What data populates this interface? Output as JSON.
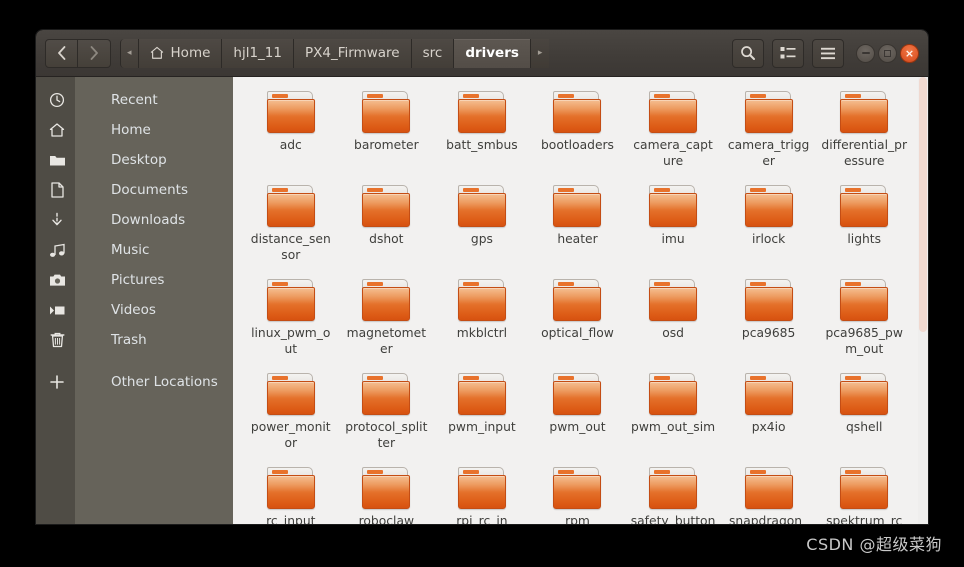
{
  "window": {
    "title": "drivers",
    "nav": {
      "back_label": "‹",
      "forward_label": "›"
    },
    "breadcrumb": {
      "overflow_left": "◂",
      "overflow_right": "▸",
      "items": [
        {
          "label": "Home",
          "icon": "home-icon",
          "current": false
        },
        {
          "label": "hjl1_11",
          "icon": "",
          "current": false
        },
        {
          "label": "PX4_Firmware",
          "icon": "",
          "current": false
        },
        {
          "label": "src",
          "icon": "",
          "current": false
        },
        {
          "label": "drivers",
          "icon": "",
          "current": true
        }
      ]
    },
    "toolbar": {
      "search_label": "search-icon",
      "view_label": "list-view-icon",
      "menu_label": "hamburger-menu-icon"
    },
    "controls": {
      "minimize_label": "minimize",
      "maximize_label": "maximize",
      "close_label": "×"
    }
  },
  "sidebar": {
    "items": [
      {
        "label": "Recent",
        "icon": "clock-icon"
      },
      {
        "label": "Home",
        "icon": "home-icon"
      },
      {
        "label": "Desktop",
        "icon": "folder-icon"
      },
      {
        "label": "Documents",
        "icon": "document-icon"
      },
      {
        "label": "Downloads",
        "icon": "download-icon"
      },
      {
        "label": "Music",
        "icon": "music-note-icon"
      },
      {
        "label": "Pictures",
        "icon": "camera-icon"
      },
      {
        "label": "Videos",
        "icon": "video-icon"
      },
      {
        "label": "Trash",
        "icon": "trash-icon"
      },
      {
        "label": "Other Locations",
        "icon": "plus-icon"
      }
    ]
  },
  "files": {
    "items": [
      {
        "name": "adc",
        "type": "folder"
      },
      {
        "name": "barometer",
        "type": "folder"
      },
      {
        "name": "batt_smbus",
        "type": "folder"
      },
      {
        "name": "bootloaders",
        "type": "folder"
      },
      {
        "name": "camera_capture",
        "type": "folder"
      },
      {
        "name": "camera_trigger",
        "type": "folder"
      },
      {
        "name": "differential_pressure",
        "type": "folder"
      },
      {
        "name": "distance_sensor",
        "type": "folder"
      },
      {
        "name": "dshot",
        "type": "folder"
      },
      {
        "name": "gps",
        "type": "folder"
      },
      {
        "name": "heater",
        "type": "folder"
      },
      {
        "name": "imu",
        "type": "folder"
      },
      {
        "name": "irlock",
        "type": "folder"
      },
      {
        "name": "lights",
        "type": "folder"
      },
      {
        "name": "linux_pwm_out",
        "type": "folder"
      },
      {
        "name": "magnetometer",
        "type": "folder"
      },
      {
        "name": "mkblctrl",
        "type": "folder"
      },
      {
        "name": "optical_flow",
        "type": "folder"
      },
      {
        "name": "osd",
        "type": "folder"
      },
      {
        "name": "pca9685",
        "type": "folder"
      },
      {
        "name": "pca9685_pwm_out",
        "type": "folder"
      },
      {
        "name": "power_monitor",
        "type": "folder"
      },
      {
        "name": "protocol_splitter",
        "type": "folder"
      },
      {
        "name": "pwm_input",
        "type": "folder"
      },
      {
        "name": "pwm_out",
        "type": "folder"
      },
      {
        "name": "pwm_out_sim",
        "type": "folder"
      },
      {
        "name": "px4io",
        "type": "folder"
      },
      {
        "name": "qshell",
        "type": "folder"
      },
      {
        "name": "rc_input",
        "type": "folder"
      },
      {
        "name": "roboclaw",
        "type": "folder"
      },
      {
        "name": "rpi_rc_in",
        "type": "folder"
      },
      {
        "name": "rpm",
        "type": "folder"
      },
      {
        "name": "safety_button",
        "type": "folder"
      },
      {
        "name": "snapdragon_pwm_out",
        "type": "folder"
      },
      {
        "name": "spektrum_rc",
        "type": "folder"
      }
    ]
  },
  "watermark": {
    "text": "CSDN @超级菜狗"
  },
  "colors": {
    "titlebar": "#413d39",
    "sidebar": "#66635a",
    "rail": "#4f4c45",
    "file_pane": "#f2f1f0",
    "folder_orange": "#e4702a",
    "close_button": "#e0592a",
    "scrollbar_thumb": "#f0d9d0"
  }
}
